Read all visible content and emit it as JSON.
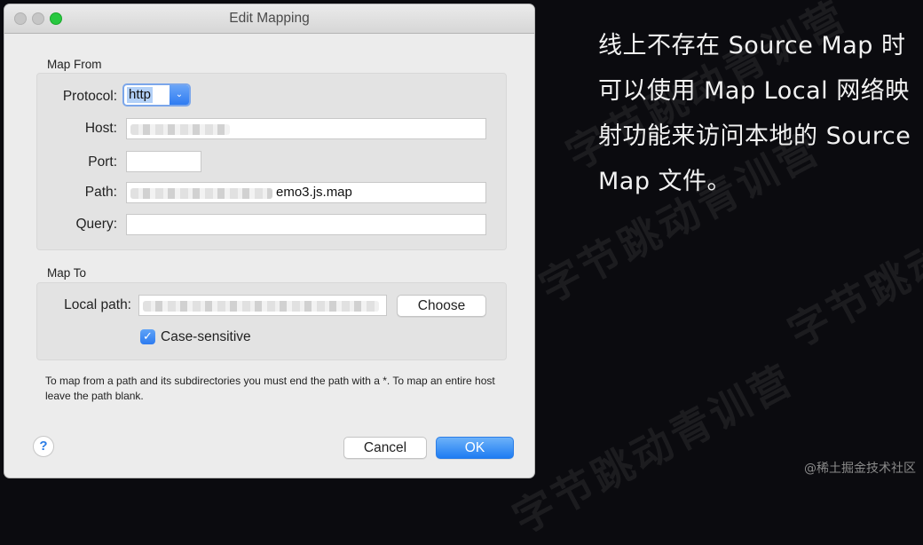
{
  "dialog": {
    "title": "Edit Mapping",
    "map_from": {
      "section_label": "Map From",
      "protocol_label": "Protocol:",
      "protocol_value": "http",
      "host_label": "Host:",
      "host_value": "",
      "port_label": "Port:",
      "port_value": "",
      "path_label": "Path:",
      "path_value": "emo3.js.map",
      "query_label": "Query:",
      "query_value": ""
    },
    "map_to": {
      "section_label": "Map To",
      "local_path_label": "Local path:",
      "local_path_value": "",
      "choose_label": "Choose",
      "case_sensitive_label": "Case-sensitive",
      "case_sensitive_checked": true
    },
    "hint": "To map from a path and its subdirectories you must end the path with a *. To map an entire host leave the path blank.",
    "help_label": "?",
    "cancel_label": "Cancel",
    "ok_label": "OK"
  },
  "side_text": {
    "lines": [
      "线上不存在 Source Map 时",
      "可以使用 Map Local 网络映",
      "射功能来访问本地的 Source",
      "Map 文件。"
    ]
  },
  "watermark": "字节跳动青训营",
  "credit": "@稀土掘金技术社区",
  "colors": {
    "accent": "#2b7de6",
    "background": "#0b0b0f",
    "dialog": "#ececec"
  }
}
